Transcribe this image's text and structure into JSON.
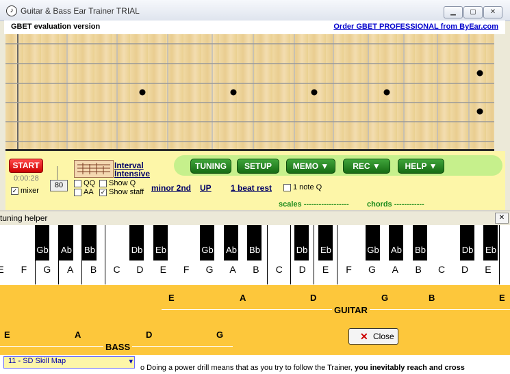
{
  "window": {
    "title": "Guitar & Bass Ear Trainer TRIAL",
    "icon": "music-note-icon"
  },
  "header": {
    "eval_text": "GBET evaluation version",
    "order_link": "Order GBET PROFESSIONAL from ByEar.com"
  },
  "controls": {
    "start": "START",
    "time": "0:00:28",
    "mixer": "mixer",
    "tempo": "80",
    "exercise_line1": "Interval",
    "exercise_line2": "Intensive",
    "qq": "QQ",
    "aa": "AA",
    "show_q": "Show Q",
    "show_staff": "Show staff",
    "interval": "minor 2nd",
    "direction": "UP",
    "rest": "1 beat rest",
    "one_note_q": "1 note Q",
    "scales": "scales ------------------",
    "chords": "chords ------------"
  },
  "menu": {
    "tuning": "TUNING",
    "setup": "SETUP",
    "memo": "MEMO",
    "rec": "REC",
    "help": "HELP"
  },
  "tuning_helper": {
    "title": "tuning helper",
    "white_keys": [
      "E",
      "F",
      "G",
      "A",
      "B",
      "C",
      "D",
      "E",
      "F",
      "G",
      "A",
      "B",
      "C",
      "D",
      "E",
      "F",
      "G",
      "A",
      "B",
      "C",
      "D",
      "E"
    ],
    "black_keys": [
      "Gb",
      "Ab",
      "Bb",
      "Db",
      "Eb",
      "Gb",
      "Ab",
      "Bb",
      "Db",
      "Eb",
      "Gb",
      "Ab",
      "Bb",
      "Db",
      "Eb"
    ],
    "guitar_notes": [
      "E",
      "A",
      "D",
      "G",
      "B",
      "E"
    ],
    "guitar_label": "GUITAR",
    "bass_notes": [
      "E",
      "A",
      "D",
      "G"
    ],
    "bass_label": "BASS",
    "close": "Close"
  },
  "status": {
    "select_value": "11 - SD Skill Map",
    "message_plain": "o Doing a power drill means that as you try to follow the Trainer, ",
    "message_bold": "you inevitably reach and cross"
  },
  "colors": {
    "panel": "#fdf6a8",
    "green": "#1f7f1b",
    "start": "#e00000",
    "orange": "#fdc73b"
  }
}
